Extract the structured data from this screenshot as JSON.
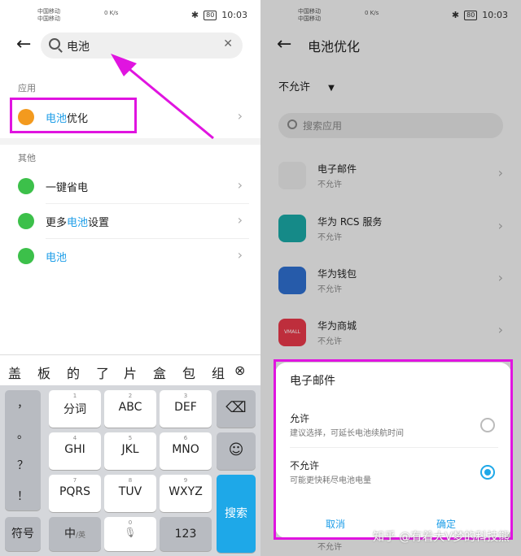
{
  "status": {
    "carrier1": "中国移动",
    "carrier2": "中国移动",
    "net_speed": "0 K/s",
    "time": "10:03",
    "battery": "80"
  },
  "left": {
    "search_value": "电池",
    "section_apps": "应用",
    "section_other": "其他",
    "app_result": {
      "hl": "电池",
      "rest": "优化"
    },
    "others": [
      {
        "pre": "",
        "hl": "",
        "post": "一键省电"
      },
      {
        "pre": "更多",
        "hl": "电池",
        "post": "设置"
      },
      {
        "pre": "",
        "hl": "电池",
        "post": ""
      }
    ],
    "candidates": [
      "盖",
      "板",
      "的",
      "了",
      "片",
      "盒",
      "包",
      "组"
    ],
    "keys": {
      "comma": "，",
      "period": "。",
      "question": "？",
      "exclaim": "！",
      "k1": "分词",
      "k2": "ABC",
      "k3": "DEF",
      "k4": "GHI",
      "k5": "JKL",
      "k6": "MNO",
      "k7": "PQRS",
      "k8": "TUV",
      "k9": "WXYZ",
      "n1": "1",
      "n2": "2",
      "n3": "3",
      "n4": "4",
      "n5": "5",
      "n6": "6",
      "n7": "7",
      "n8": "8",
      "n9": "9",
      "n0": "0",
      "symbol": "符号",
      "lang": "中",
      "lang_sub": "/英",
      "num123": "123",
      "search": "搜索"
    }
  },
  "right": {
    "title": "电池优化",
    "filter": "不允许",
    "search_placeholder": "搜索应用",
    "apps": [
      {
        "name": "电子邮件",
        "status": "不允许"
      },
      {
        "name": "华为 RCS 服务",
        "status": "不允许"
      },
      {
        "name": "华为钱包",
        "status": "不允许"
      },
      {
        "name": "华为商城",
        "status": "不允许",
        "icon_text": "VMALL"
      }
    ],
    "dialog": {
      "title": "电子邮件",
      "opt1_title": "允许",
      "opt1_desc": "建议选择，可延长电池续航时间",
      "opt2_title": "不允许",
      "opt2_desc": "可能更快耗尽电池电量",
      "cancel": "取消",
      "confirm": "确定",
      "selected": "不允许"
    },
    "watermark": "知乎 @有着大V梦的科技熊",
    "peek_status": "不允许"
  },
  "colors": {
    "accent": "#1e9ee8",
    "annotation": "#e014e0"
  }
}
